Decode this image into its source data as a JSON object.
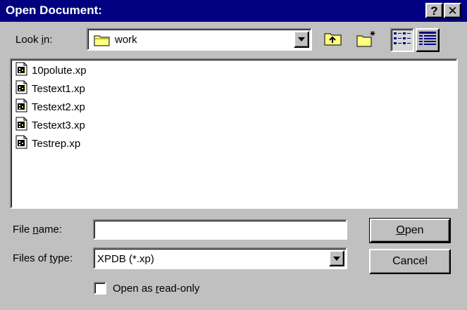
{
  "dialog": {
    "title": "Open Document:",
    "help_glyph": "?",
    "close_glyph": "✕"
  },
  "look_in": {
    "label_pre": "Look ",
    "label_accel": "i",
    "label_post": "n:",
    "value": "work",
    "folder_icon": "folder-icon"
  },
  "toolbar": {
    "up_folder": "up-one-level-icon",
    "new_folder": "create-new-folder-icon",
    "list_view": "list-view-icon",
    "details_view": "details-view-icon",
    "active_view": "list"
  },
  "files": [
    {
      "name": "10polute.xp",
      "icon": "xp-document-icon"
    },
    {
      "name": "Testext1.xp",
      "icon": "xp-document-icon"
    },
    {
      "name": "Testext2.xp",
      "icon": "xp-document-icon"
    },
    {
      "name": "Testext3.xp",
      "icon": "xp-document-icon"
    },
    {
      "name": "Testrep.xp",
      "icon": "xp-document-icon"
    }
  ],
  "file_name": {
    "label_pre": "File ",
    "label_accel": "n",
    "label_post": "ame:",
    "value": ""
  },
  "file_type": {
    "label_pre": "Files of ",
    "label_accel": "t",
    "label_post": "ype:",
    "value": "XPDB (*.xp)"
  },
  "buttons": {
    "open_accel": "O",
    "open_rest": "pen",
    "cancel": "Cancel"
  },
  "read_only": {
    "label_pre": "Open as ",
    "label_accel": "r",
    "label_post": "ead-only",
    "checked": false
  }
}
